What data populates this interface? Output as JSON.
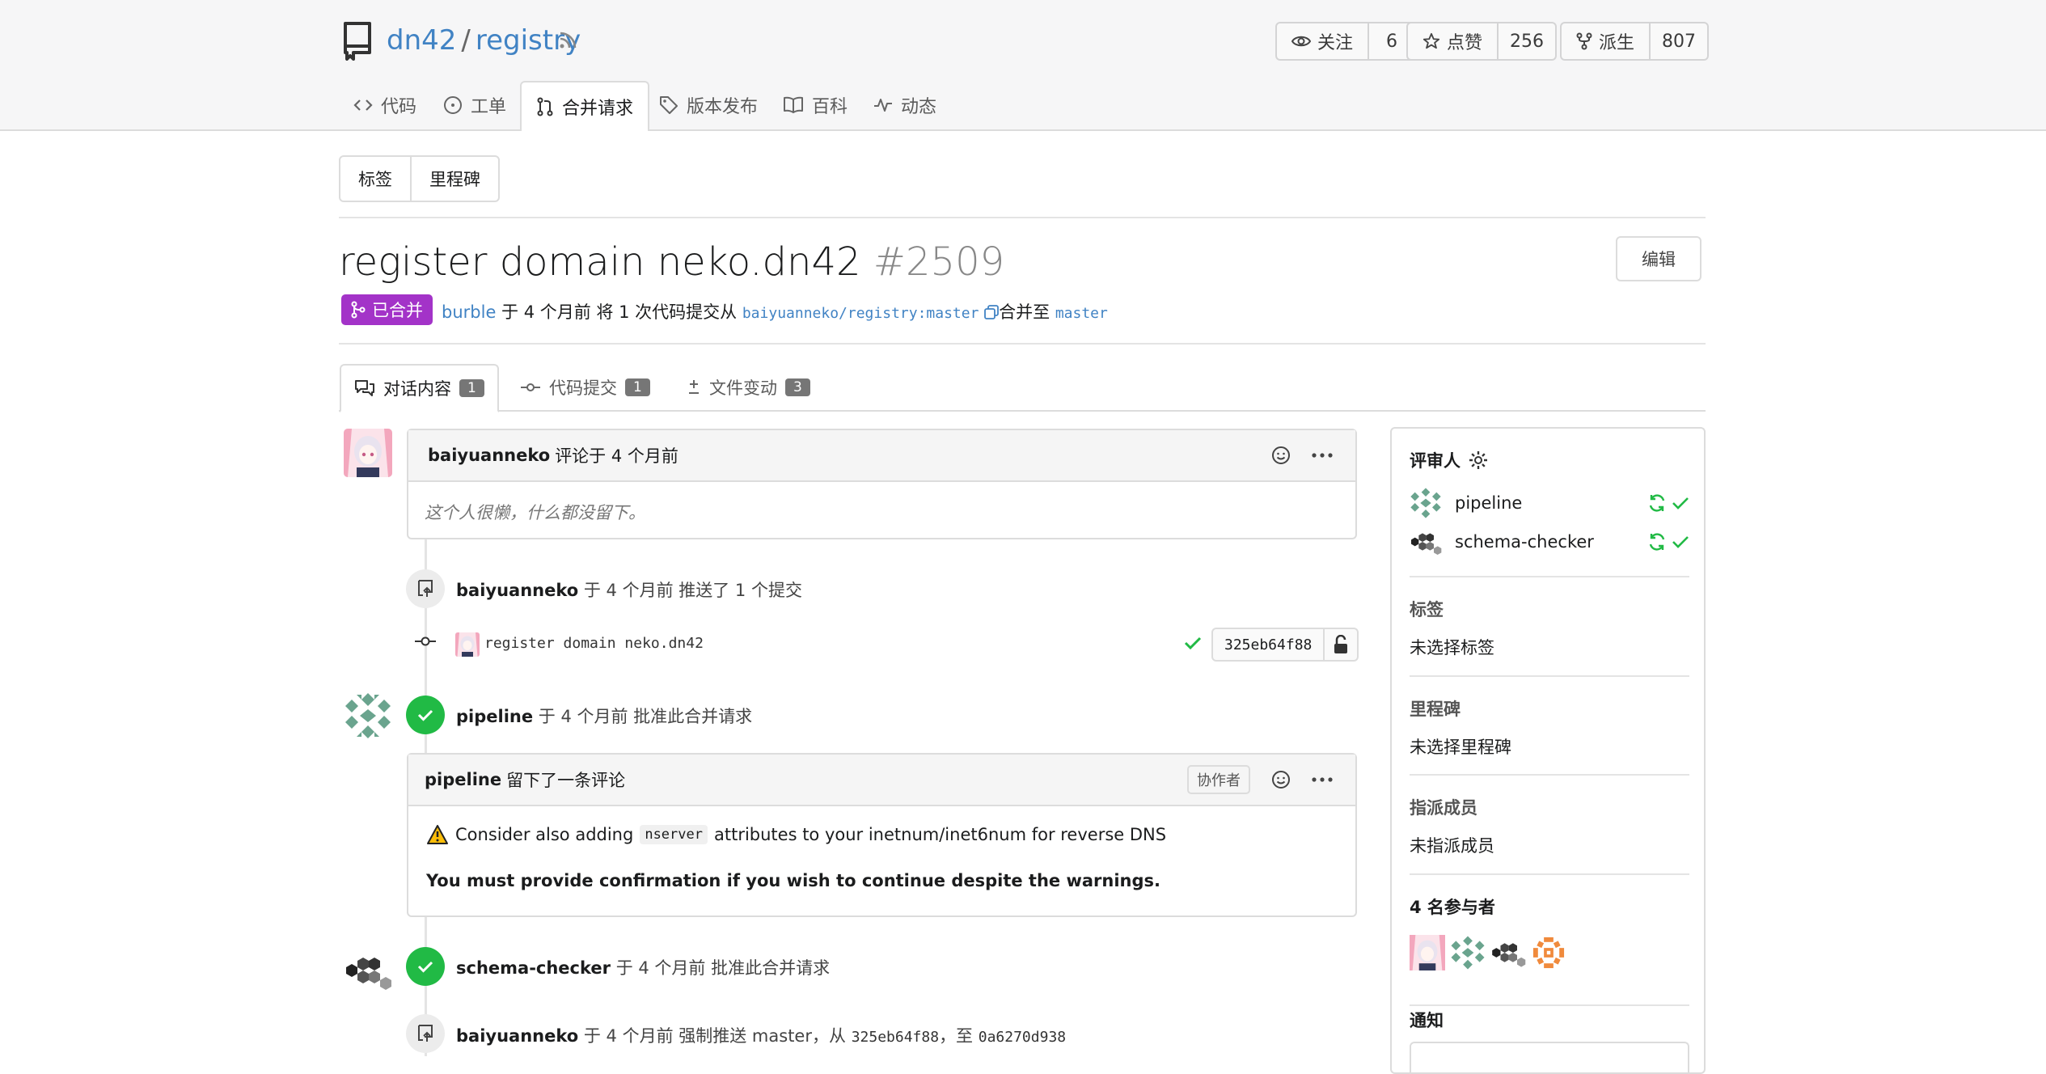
{
  "repo": {
    "owner": "dn42",
    "name": "registry"
  },
  "header_buttons": [
    {
      "label": "关注",
      "count": "6"
    },
    {
      "label": "点赞",
      "count": "256"
    },
    {
      "label": "派生",
      "count": "807"
    }
  ],
  "nav": {
    "code": "代码",
    "issues": "工单",
    "pulls": "合并请求",
    "releases": "版本发布",
    "wiki": "百科",
    "activity": "动态"
  },
  "labels_btn": "标签",
  "milestones_btn": "里程碑",
  "pr": {
    "title": "register domain neko.dn42",
    "number": "#2509",
    "edit": "编辑",
    "status": "已合并",
    "author": "burble",
    "meta_text": "于 4 个月前 将 1 次代码提交从",
    "source_branch": "baiyuanneko/registry:master",
    "merge_to": "合并至",
    "target_branch": "master"
  },
  "tabs": [
    {
      "label": "对话内容",
      "count": "1"
    },
    {
      "label": "代码提交",
      "count": "1"
    },
    {
      "label": "文件变动",
      "count": "3"
    }
  ],
  "timeline": {
    "first_comment": {
      "user": "baiyuanneko",
      "action": "评论于 4 个月前",
      "body": "这个人很懒，什么都没留下。"
    },
    "push_event": {
      "user": "baiyuanneko",
      "text": "于 4 个月前 推送了 1 个提交"
    },
    "commit": {
      "message": "register domain neko.dn42",
      "sha": "325eb64f88"
    },
    "approve1": {
      "user": "pipeline",
      "text": "于 4 个月前 批准此合并请求"
    },
    "review_comment": {
      "user": "pipeline",
      "action": "留下了一条评论",
      "tag": "协作者",
      "warning_pre": "Consider also adding",
      "warning_code": "nserver",
      "warning_post": "attributes to your inetnum/inet6num for reverse DNS",
      "bold_line": "You must provide confirmation if you wish to continue despite the warnings."
    },
    "approve2": {
      "user": "schema-checker",
      "text": "于 4 个月前 批准此合并请求"
    },
    "force_push": {
      "user": "baiyuanneko",
      "text_pre": "于 4 个月前 强制推送 master，从",
      "from_sha": "325eb64f88",
      "to_word": "，至",
      "to_sha": "0a6270d938"
    }
  },
  "sidebar": {
    "reviewers_title": "评审人",
    "reviewers": [
      {
        "name": "pipeline"
      },
      {
        "name": "schema-checker"
      }
    ],
    "labels_title": "标签",
    "labels_value": "未选择标签",
    "milestone_title": "里程碑",
    "milestone_value": "未选择里程碑",
    "assignees_title": "指派成员",
    "assignees_value": "未指派成员",
    "participants_title": "4 名参与者",
    "notifications_title": "通知"
  },
  "colors": {
    "link": "#4183c4",
    "merged": "#a333c8",
    "success": "#21ba45"
  }
}
